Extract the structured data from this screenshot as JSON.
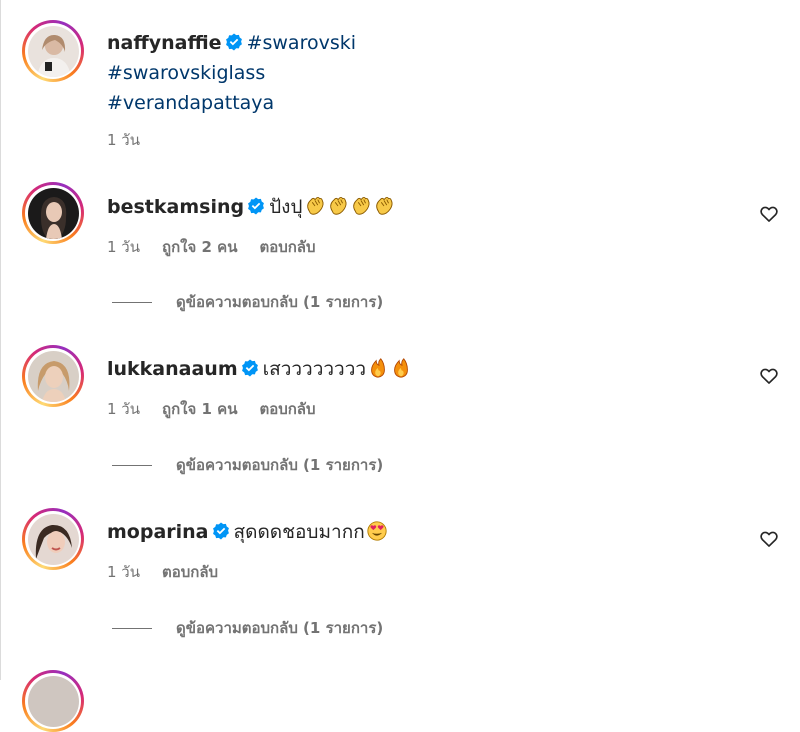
{
  "caption": {
    "username": "naffynaffie",
    "hashtags": [
      "#swarovski",
      "#swarovskiglass",
      "#verandapattaya"
    ],
    "time": "1 วัน"
  },
  "comments": [
    {
      "username": "bestkamsing",
      "text": "ปังปุ",
      "emojis": [
        "clapping-hands",
        "clapping-hands",
        "clapping-hands",
        "clapping-hands"
      ],
      "time": "1 วัน",
      "likes": "ถูกใจ 2 คน",
      "reply": "ตอบกลับ",
      "view_replies": "ดูข้อความตอบกลับ (1 รายการ)"
    },
    {
      "username": "lukkanaaum",
      "text": "เสวววววววว",
      "emojis": [
        "fire",
        "fire"
      ],
      "time": "1 วัน",
      "likes": "ถูกใจ 1 คน",
      "reply": "ตอบกลับ",
      "view_replies": "ดูข้อความตอบกลับ (1 รายการ)"
    },
    {
      "username": "moparina",
      "text": "สุดดดชอบมากก",
      "emojis": [
        "heart-eyes"
      ],
      "time": "1 วัน",
      "reply": "ตอบกลับ",
      "view_replies": "ดูข้อความตอบกลับ (1 รายการ)"
    }
  ],
  "colors": {
    "link": "#00376b",
    "verified": "#0095f6",
    "secondary_text": "#737373"
  }
}
